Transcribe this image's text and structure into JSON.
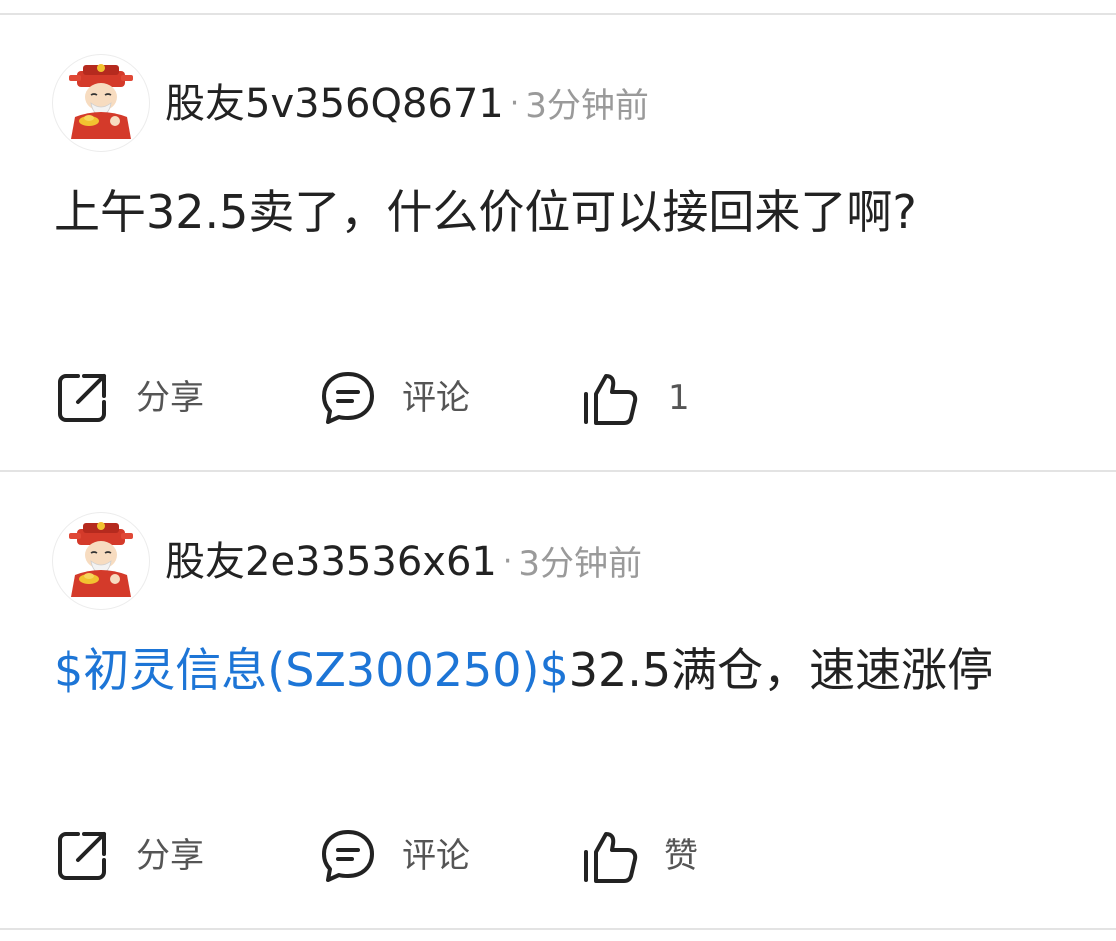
{
  "posts": [
    {
      "author": "股友5v356Q8671",
      "dot": "·",
      "time": "3分钟前",
      "content": "上午32.5卖了，什么价位可以接回来了啊?",
      "actions": {
        "share": "分享",
        "comment": "评论",
        "like": "1"
      }
    },
    {
      "author": "股友2e33536x61",
      "dot": "·",
      "time": "3分钟前",
      "stock_link": "$初灵信息(SZ300250)$",
      "content": "32.5满仓，速速涨停",
      "actions": {
        "share": "分享",
        "comment": "评论",
        "like": "赞"
      }
    }
  ],
  "colors": {
    "link": "#1d75d6",
    "meta_text": "#9a9a9a",
    "divider": "#e3e3e3"
  },
  "icons": {
    "avatar": "caishen-avatar-icon",
    "share": "share-icon",
    "comment": "comment-bubble-icon",
    "like": "thumbs-up-icon"
  }
}
